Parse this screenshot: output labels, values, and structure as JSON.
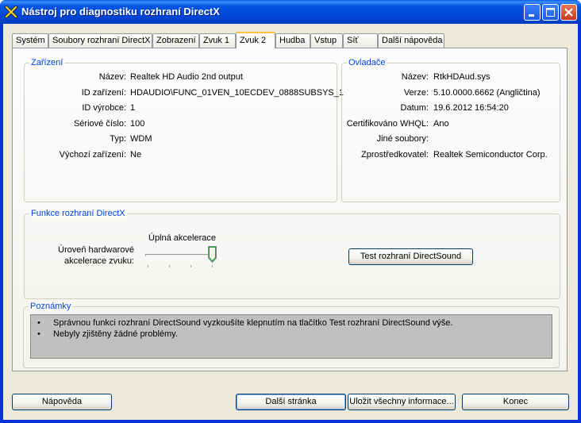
{
  "window": {
    "title": "Nástroj pro diagnostiku rozhraní DirectX"
  },
  "tabs": [
    {
      "label": "Systém"
    },
    {
      "label": "Soubory rozhraní DirectX"
    },
    {
      "label": "Zobrazení"
    },
    {
      "label": "Zvuk 1"
    },
    {
      "label": "Zvuk 2",
      "selected": true
    },
    {
      "label": "Hudba"
    },
    {
      "label": "Vstup"
    },
    {
      "label": "Síť"
    },
    {
      "label": "Další nápověda"
    }
  ],
  "device": {
    "legend": "Zařízení",
    "rows": [
      {
        "label": "Název:",
        "value": "Realtek HD Audio 2nd output"
      },
      {
        "label": "ID zařízení:",
        "value": "HDAUDIO\\FUNC_01VEN_10ECDEV_0888SUBSYS_1"
      },
      {
        "label": "ID výrobce:",
        "value": "1"
      },
      {
        "label": "Sériové číslo:",
        "value": "100"
      },
      {
        "label": "Typ:",
        "value": "WDM"
      },
      {
        "label": "Výchozí zařízení:",
        "value": "Ne"
      }
    ]
  },
  "driver": {
    "legend": "Ovladače",
    "rows": [
      {
        "label": "Název:",
        "value": "RtkHDAud.sys"
      },
      {
        "label": "Verze:",
        "value": "5.10.0000.6662 (Angličtina)"
      },
      {
        "label": "Datum:",
        "value": "19.6.2012 16:54:20"
      },
      {
        "label": "Certifikováno WHQL:",
        "value": "Ano"
      },
      {
        "label": "Jiné soubory:",
        "value": ""
      },
      {
        "label": "Zprostředkovatel:",
        "value": "Realtek Semiconductor Corp."
      }
    ]
  },
  "directx_features": {
    "legend": "Funkce rozhraní DirectX",
    "accel_label_line1": "Úroveň hardwarové",
    "accel_label_line2": "akcelerace zvuku:",
    "accel_value_text": "Úplná akcelerace",
    "accel_level": {
      "current": 3,
      "max": 3
    },
    "test_button": "Test rozhraní DirectSound"
  },
  "notes": {
    "legend": "Poznámky",
    "bullet": "•",
    "items": [
      "Správnou funkci rozhraní DirectSound vyzkoušíte klepnutím na tlačítko Test rozhraní DirectSound výše.",
      "Nebyly zjištěny žádné problémy."
    ]
  },
  "footer": {
    "help": "Nápověda",
    "next": "Další stránka",
    "save": "Uložit všechny informace...",
    "exit": "Konec"
  },
  "colors": {
    "titlebar": "#0054e3",
    "accent_legend": "#0046d5",
    "tab_highlight": "#ffc83c",
    "dialog_bg": "#ece9d8"
  }
}
